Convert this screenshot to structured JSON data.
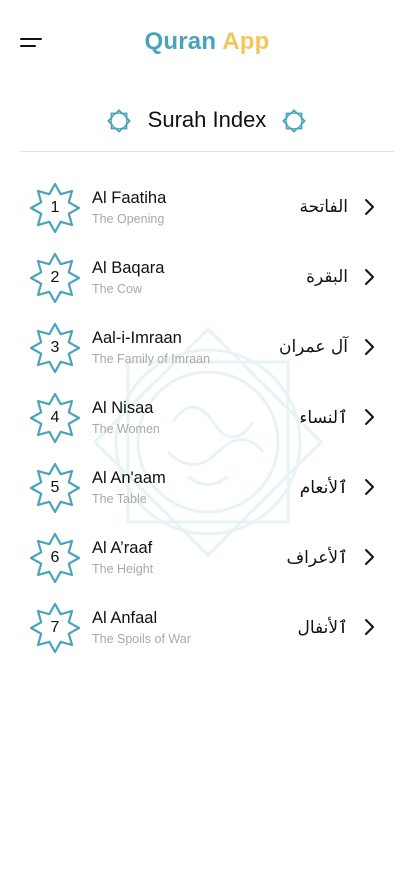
{
  "header": {
    "title_part1": "Quran",
    "title_part2": "App",
    "menu_icon": "hamburger-menu-icon"
  },
  "section": {
    "title": "Surah Index",
    "ornament_icon": "octagon-star-ornament-icon"
  },
  "colors": {
    "primary": "#4aa3bd",
    "accent": "#f3c65a",
    "muted_text": "#a9a9a9"
  },
  "surahs": [
    {
      "number": "1",
      "name": "Al Faatiha",
      "meaning": "The Opening",
      "arabic": "الفاتحة"
    },
    {
      "number": "2",
      "name": "Al Baqara",
      "meaning": "The Cow",
      "arabic": "البقرة"
    },
    {
      "number": "3",
      "name": "Aal-i-Imraan",
      "meaning": "The Family of Imraan",
      "arabic": "آل عمران"
    },
    {
      "number": "4",
      "name": "Al Nisaa",
      "meaning": "The Women",
      "arabic": "ٱلنساء"
    },
    {
      "number": "5",
      "name": "Al An'aam",
      "meaning": "The Table",
      "arabic": "ٱلأنعام"
    },
    {
      "number": "6",
      "name": "Al A’raaf",
      "meaning": "The Height",
      "arabic": "ٱلأعراف"
    },
    {
      "number": "7",
      "name": "Al Anfaal",
      "meaning": "The Spoils of War",
      "arabic": "ٱلأنفال"
    }
  ]
}
